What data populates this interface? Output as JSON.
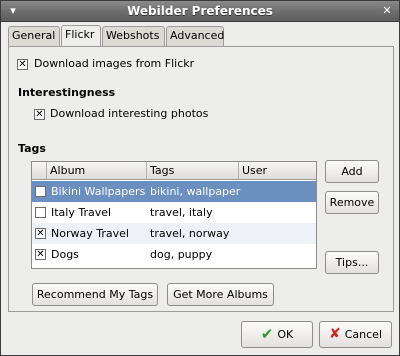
{
  "window": {
    "title": "Webilder Preferences",
    "menu_icon": "window-menu-icon",
    "close_icon": "close-icon"
  },
  "tabs": [
    {
      "label": "General"
    },
    {
      "label": "Flickr"
    },
    {
      "label": "Webshots"
    },
    {
      "label": "Advanced"
    }
  ],
  "flickr": {
    "download_images_label": "Download images from Flickr",
    "download_images_checked": true,
    "interestingness_heading": "Interestingness",
    "download_interesting_label": "Download interesting photos",
    "download_interesting_checked": true,
    "tags_heading": "Tags"
  },
  "table": {
    "columns": [
      "Album",
      "Tags",
      "User"
    ],
    "rows": [
      {
        "checked": true,
        "album": "Bikini Wallpapers",
        "tags": "bikini, wallpaper",
        "user": ""
      },
      {
        "checked": false,
        "album": "Italy Travel",
        "tags": "travel, italy",
        "user": ""
      },
      {
        "checked": true,
        "album": "Norway Travel",
        "tags": "travel, norway",
        "user": ""
      },
      {
        "checked": true,
        "album": "Dogs",
        "tags": "dog, puppy",
        "user": ""
      }
    ],
    "selected_row": 0
  },
  "buttons": {
    "add": "Add",
    "remove": "Remove",
    "tips": "Tips...",
    "recommend": "Recommend My Tags",
    "more_albums": "Get More Albums",
    "ok": "OK",
    "cancel": "Cancel"
  },
  "colors": {
    "selection": "#6b8fbf",
    "titlebar": "#6c6c6c"
  }
}
